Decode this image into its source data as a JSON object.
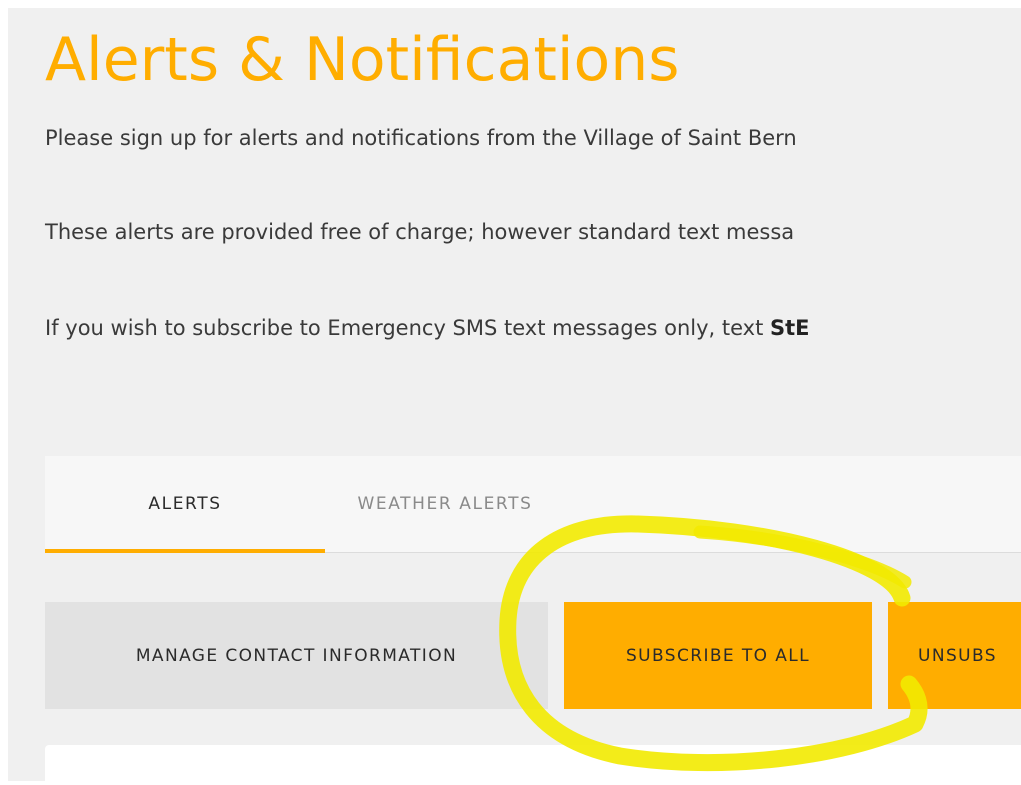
{
  "header": {
    "title": "Alerts & Notifications"
  },
  "intro": {
    "line1": "Please sign up for alerts and notifications from the Village of Saint Bern",
    "line2": "These alerts are provided free of charge; however standard text messa",
    "line3_prefix": "If you wish to subscribe to Emergency SMS text messages only, text ",
    "line3_bold": "StE"
  },
  "tabs": [
    {
      "label": "ALERTS",
      "active": true
    },
    {
      "label": "WEATHER ALERTS",
      "active": false
    }
  ],
  "actions": {
    "manage_label": "MANAGE CONTACT INFORMATION",
    "subscribe_label": "SUBSCRIBE TO ALL",
    "unsubscribe_label": "UNSUBS"
  },
  "colors": {
    "accent": "#ffad00",
    "highlight_marker": "#f2ea00",
    "page_background": "#f0f0f0",
    "secondary_button": "#e2e2e2"
  }
}
